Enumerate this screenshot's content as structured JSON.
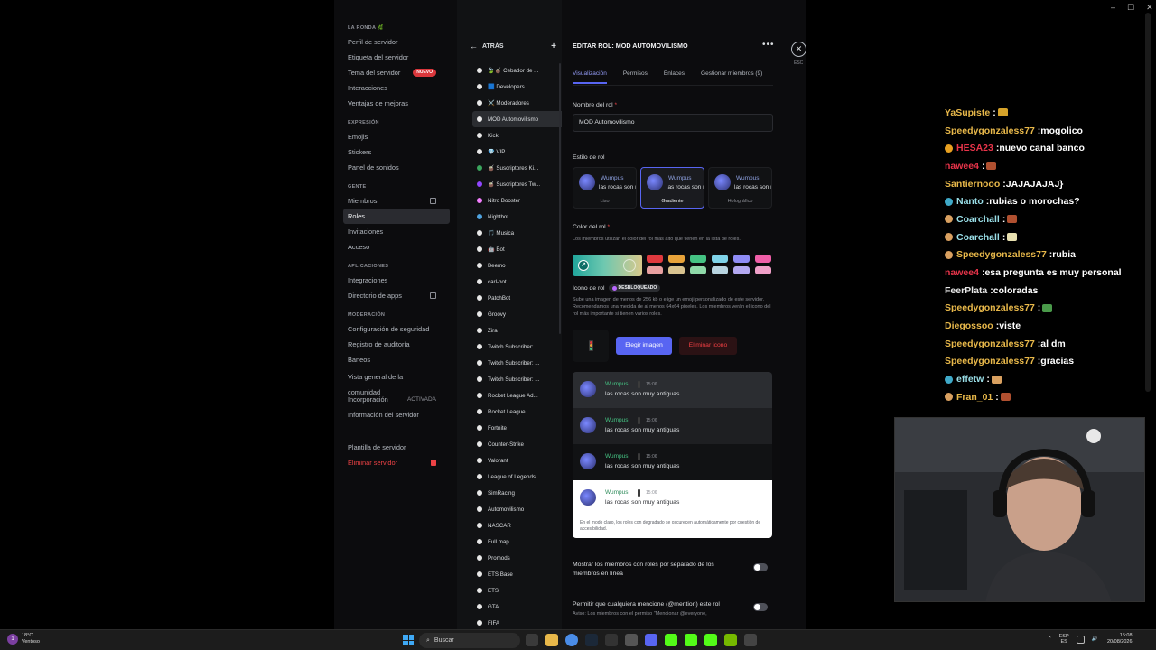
{
  "sidebar": {
    "sections": [
      {
        "heading": "LA RONDA 🌿",
        "items": [
          {
            "label": "Perfil de servidor"
          },
          {
            "label": "Etiqueta del servidor"
          },
          {
            "label": "Tema del servidor",
            "badge": "NUEVO"
          },
          {
            "label": "Interacciones"
          },
          {
            "label": "Ventajas de mejoras"
          }
        ]
      },
      {
        "heading": "EXPRESIÓN",
        "items": [
          {
            "label": "Emojis"
          },
          {
            "label": "Stickers"
          },
          {
            "label": "Panel de sonidos"
          }
        ]
      },
      {
        "heading": "GENTE",
        "items": [
          {
            "label": "Miembros",
            "external": true
          },
          {
            "label": "Roles",
            "active": true
          },
          {
            "label": "Invitaciones"
          },
          {
            "label": "Acceso"
          }
        ]
      },
      {
        "heading": "APLICACIONES",
        "items": [
          {
            "label": "Integraciones"
          },
          {
            "label": "Directorio de apps",
            "external": true
          }
        ]
      },
      {
        "heading": "MODERACIÓN",
        "items": [
          {
            "label": "Configuración de seguridad"
          },
          {
            "label": "Registro de auditoría"
          },
          {
            "label": "Baneos"
          }
        ]
      }
    ],
    "community": [
      {
        "label": "Vista general de la comunidad"
      },
      {
        "label": "Incorporación",
        "right": "ACTIVADA"
      },
      {
        "label": "Información del servidor"
      }
    ],
    "bottom": [
      {
        "label": "Plantilla de servidor"
      },
      {
        "label": "Eliminar servidor",
        "danger": true
      }
    ]
  },
  "roles_panel": {
    "back_label": "ATRÁS",
    "roles": [
      {
        "name": "🍃🧉 Cebador de ...",
        "color": "#e8e8e8"
      },
      {
        "name": "🟦 Developers",
        "color": "#e8e8e8"
      },
      {
        "name": "⚔️ Moderadores",
        "color": "#e8e8e8"
      },
      {
        "name": "MOD Automovilismo",
        "color": "#e8e8e8",
        "active": true
      },
      {
        "name": "Kick",
        "color": "#e8e8e8"
      },
      {
        "name": "💎 VIP",
        "color": "#e8e8e8"
      },
      {
        "name": "🧉 Suscriptores Ki...",
        "color": "#3ba55d"
      },
      {
        "name": "🧉 Suscriptores Tw...",
        "color": "#9146ff"
      },
      {
        "name": "Nitro Booster",
        "color": "#f47fff"
      },
      {
        "name": "Nightbot",
        "color": "#4fa3e0"
      },
      {
        "name": "🎵 Musica",
        "color": "#e8e8e8"
      },
      {
        "name": "🤖 Bot",
        "color": "#e8e8e8"
      },
      {
        "name": "Beemo",
        "color": "#e8e8e8"
      },
      {
        "name": "carl-bot",
        "color": "#e8e8e8"
      },
      {
        "name": "PatchBot",
        "color": "#e8e8e8"
      },
      {
        "name": "Groovy",
        "color": "#e8e8e8"
      },
      {
        "name": "Zira",
        "color": "#e8e8e8"
      },
      {
        "name": "Twitch Subscriber: ...",
        "color": "#e8e8e8"
      },
      {
        "name": "Twitch Subscriber: ...",
        "color": "#e8e8e8"
      },
      {
        "name": "Twitch Subscriber: ...",
        "color": "#e8e8e8"
      },
      {
        "name": "Rocket League Ad...",
        "color": "#e8e8e8"
      },
      {
        "name": "Rocket League",
        "color": "#e8e8e8"
      },
      {
        "name": "Fortnite",
        "color": "#e8e8e8"
      },
      {
        "name": "Counter-Strike",
        "color": "#e8e8e8"
      },
      {
        "name": "Valorant",
        "color": "#e8e8e8"
      },
      {
        "name": "League of Legends",
        "color": "#e8e8e8"
      },
      {
        "name": "SimRacing",
        "color": "#e8e8e8"
      },
      {
        "name": "Automovilismo",
        "color": "#e8e8e8"
      },
      {
        "name": "NASCAR",
        "color": "#e8e8e8"
      },
      {
        "name": "Full map",
        "color": "#e8e8e8"
      },
      {
        "name": "Promods",
        "color": "#e8e8e8"
      },
      {
        "name": "ETS Base",
        "color": "#e8e8e8"
      },
      {
        "name": "ETS",
        "color": "#e8e8e8"
      },
      {
        "name": "GTA",
        "color": "#e8e8e8"
      },
      {
        "name": "FIFA",
        "color": "#e8e8e8"
      }
    ]
  },
  "edit": {
    "title": "EDITAR ROL: MOD AUTOMOVILISMO",
    "tabs": [
      "Visualización",
      "Permisos",
      "Enlaces",
      "Gestionar miembros (9)"
    ],
    "name_label": "Nombre del rol",
    "name_value": "MOD Automovilismo",
    "style_label": "Estilo de rol",
    "style_cards": [
      {
        "label": "Liso",
        "name": "Wumpus",
        "msg": "las rocas son m"
      },
      {
        "label": "Gradiente",
        "name": "Wumpus",
        "msg": "las rocas son m",
        "selected": true
      },
      {
        "label": "Holográfico",
        "name": "Wumpus",
        "msg": "las rocas son m"
      }
    ],
    "color_label": "Color del rol",
    "color_desc": "Los miembros utilizan el color del rol más alto que tienen en la lista de roles.",
    "swatches": [
      "#e0393e",
      "#e8a33a",
      "#45c383",
      "#7fd3e8",
      "#8f8cf5",
      "#f05fa8",
      "#e8a0a0",
      "#d9c38f",
      "#8fd9a8",
      "#b8d4e0",
      "#b3a8f0",
      "#f0a0c8"
    ],
    "icon_label": "Icono de rol",
    "unlocked_label": "DESBLOQUEADO",
    "icon_desc": "Sube una imagen de menos de 256 kb o elige un emoji personalizado de este servidor. Recomendamos una medida de al menos 64x64 píxeles. Los miembros verán el icono del rol más importante si tienen varios roles.",
    "choose_image": "Elegir imagen",
    "remove_icon": "Eliminar icono",
    "preview": {
      "name": "Wumpus",
      "time": "15:06",
      "message": "las rocas son muy antiguas",
      "note": "En el modo claro, los roles con degradado se oscurecen automáticamente por cuestión de accesibilidad."
    },
    "toggle1": "Mostrar los miembros con roles por separado de los miembros en línea",
    "toggle2": "Permitir que cualquiera mencione (@mention) este rol",
    "toggle2_desc": "Aviso: Los miembros con el permiso \"Mencionar @everyone,",
    "esc": "ESC"
  },
  "chat": [
    {
      "user": "YaSupiste",
      "text": "",
      "color": "#e8b84a",
      "emote": "#d6a32a"
    },
    {
      "user": "Speedygonzaless77",
      "text": "mogolico",
      "color": "#e8b84a"
    },
    {
      "user": "HESA23",
      "text": "nuevo canal banco",
      "color": "#e8344a",
      "badge": "#e8a020"
    },
    {
      "user": "nawee4",
      "text": "",
      "color": "#e8344a",
      "emote": "#b05030"
    },
    {
      "user": "Santiernooo",
      "text": "JAJAJAJAJ}",
      "color": "#e8b84a"
    },
    {
      "user": "Nanto",
      "text": "rubias o morochas?",
      "color": "#9adfe8",
      "badge": "#3fa9c8"
    },
    {
      "user": "Coarchall",
      "text": "",
      "color": "#9adfe8",
      "badge": "#d9a060",
      "emote": "#b05030"
    },
    {
      "user": "Coarchall",
      "text": "",
      "color": "#9adfe8",
      "badge": "#d9a060",
      "emote": "#e8e0b0"
    },
    {
      "user": "Speedygonzaless77",
      "text": "rubia",
      "color": "#e8b84a",
      "badge": "#d9a060"
    },
    {
      "user": "nawee4",
      "text": "esa pregunta es muy personal",
      "color": "#e8344a"
    },
    {
      "user": "FeerPlata",
      "text": "coloradas",
      "color": "#e8e8e8"
    },
    {
      "user": "Speedygonzaless77",
      "text": "",
      "color": "#e8b84a",
      "emote": "#4a9a4a"
    },
    {
      "user": "Diegossoo",
      "text": "viste",
      "color": "#e8b84a"
    },
    {
      "user": "Speedygonzaless77",
      "text": "al dm",
      "color": "#e8b84a"
    },
    {
      "user": "Speedygonzaless77",
      "text": "gracias",
      "color": "#e8b84a"
    },
    {
      "user": "effetw",
      "text": "",
      "color": "#9adfe8",
      "badge": "#3fa9c8",
      "emote": "#d9a060"
    },
    {
      "user": "Fran_01",
      "text": "",
      "color": "#e8b84a",
      "badge": "#d9a060",
      "emote": "#b05030"
    }
  ],
  "taskbar": {
    "temp": "18°C",
    "weather": "Ventoso",
    "search": "Buscar",
    "lang": "ESP",
    "lang2": "ES",
    "time": "15:08",
    "date": "20/08/2026"
  }
}
